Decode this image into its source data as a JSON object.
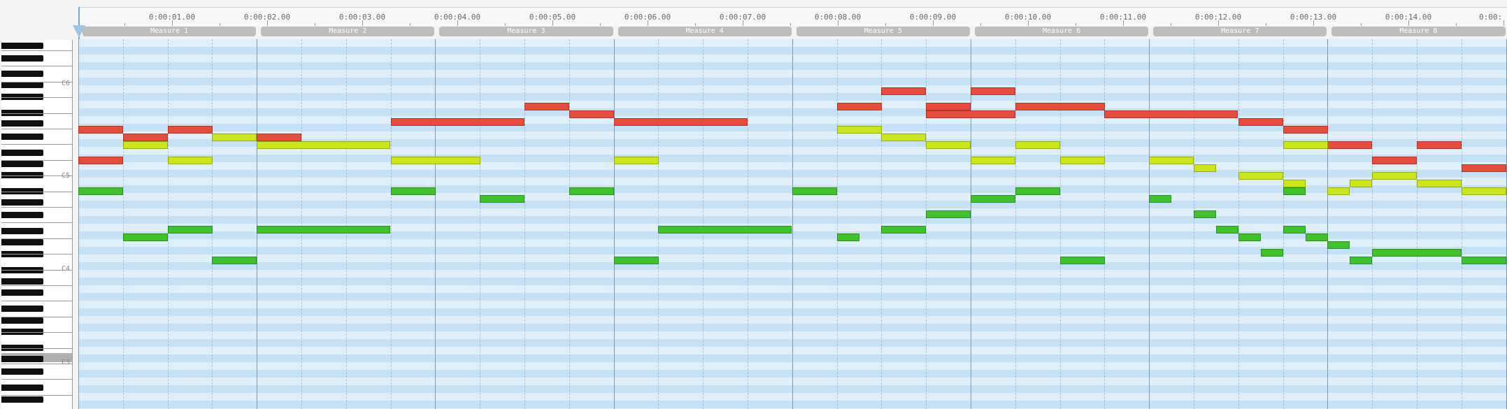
{
  "ruler": {
    "labels": [
      "0:00:01.00",
      "0:00:02.00",
      "0:00:03.00",
      "0:00:04.00",
      "0:00:05.00",
      "0:00:06.00",
      "0:00:07.00",
      "0:00:08.00",
      "0:00:09.00",
      "0:00:10.00",
      "0:00:11.00",
      "0:00:12.00",
      "0:00:13.00",
      "0:00:14.00",
      "0:00:"
    ]
  },
  "measures": [
    "Measure 1",
    "Measure 2",
    "Measure 3",
    "Measure 4",
    "Measure 5",
    "Measure 6",
    "Measure 7",
    "Measure 8"
  ],
  "keyboard": {
    "labels": [
      "C6",
      "C5",
      "C4",
      "C3"
    ],
    "highlighted_key": "C3"
  },
  "colors": {
    "melody": "#e84c3d",
    "harmony": "#cbe61a",
    "bass": "#3fc22c",
    "grid_light": "#dff0fb",
    "grid_dark": "#c4e1f6",
    "measure_tab": "#bdbdbd",
    "playhead": "#9fc4e4"
  },
  "piano_roll": {
    "beats_per_measure": 4,
    "note_start_unit": "beat",
    "pitch_unit": "row index from top",
    "tracks": [
      {
        "track": "red",
        "notes": [
          {
            "start": 0,
            "dur": 1,
            "row": 11
          },
          {
            "start": 1,
            "dur": 1,
            "row": 12
          },
          {
            "start": 2,
            "dur": 1,
            "row": 11
          },
          {
            "start": 4,
            "dur": 1,
            "row": 12
          },
          {
            "start": 7,
            "dur": 3,
            "row": 10
          },
          {
            "start": 10,
            "dur": 1,
            "row": 8
          },
          {
            "start": 11,
            "dur": 1,
            "row": 9
          },
          {
            "start": 12,
            "dur": 3,
            "row": 10
          },
          {
            "start": 17,
            "dur": 1,
            "row": 8
          },
          {
            "start": 18,
            "dur": 1,
            "row": 6
          },
          {
            "start": 19,
            "dur": 1,
            "row": 8
          },
          {
            "start": 19,
            "dur": 2,
            "row": 9
          },
          {
            "start": 20,
            "dur": 1,
            "row": 6
          },
          {
            "start": 21,
            "dur": 2,
            "row": 8
          },
          {
            "start": 23,
            "dur": 3,
            "row": 9
          },
          {
            "start": 26,
            "dur": 1,
            "row": 10
          },
          {
            "start": 27,
            "dur": 1,
            "row": 11
          },
          {
            "start": 28,
            "dur": 1,
            "row": 13
          },
          {
            "start": 29,
            "dur": 1,
            "row": 15
          },
          {
            "start": 30,
            "dur": 1,
            "row": 13
          },
          {
            "start": 31,
            "dur": 1,
            "row": 16
          },
          {
            "start": 0,
            "dur": 1,
            "row": 15
          }
        ]
      },
      {
        "track": "yellow",
        "notes": [
          {
            "start": 1,
            "dur": 1,
            "row": 13
          },
          {
            "start": 2,
            "dur": 1,
            "row": 15
          },
          {
            "start": 3,
            "dur": 1,
            "row": 12
          },
          {
            "start": 4,
            "dur": 3,
            "row": 13
          },
          {
            "start": 7,
            "dur": 2,
            "row": 15
          },
          {
            "start": 12,
            "dur": 1,
            "row": 15
          },
          {
            "start": 17,
            "dur": 1,
            "row": 11
          },
          {
            "start": 18,
            "dur": 1,
            "row": 12
          },
          {
            "start": 19,
            "dur": 1,
            "row": 13
          },
          {
            "start": 20,
            "dur": 1,
            "row": 15
          },
          {
            "start": 21,
            "dur": 1,
            "row": 13
          },
          {
            "start": 22,
            "dur": 1,
            "row": 15
          },
          {
            "start": 24,
            "dur": 1,
            "row": 15
          },
          {
            "start": 25,
            "dur": 0.5,
            "row": 16
          },
          {
            "start": 26,
            "dur": 1,
            "row": 17
          },
          {
            "start": 27,
            "dur": 0.5,
            "row": 18
          },
          {
            "start": 27,
            "dur": 1,
            "row": 13
          },
          {
            "start": 28,
            "dur": 0.5,
            "row": 19
          },
          {
            "start": 28.5,
            "dur": 0.5,
            "row": 18
          },
          {
            "start": 29,
            "dur": 1,
            "row": 17
          },
          {
            "start": 30,
            "dur": 1,
            "row": 18
          },
          {
            "start": 31,
            "dur": 1,
            "row": 19
          }
        ]
      },
      {
        "track": "green",
        "notes": [
          {
            "start": 0,
            "dur": 1,
            "row": 19
          },
          {
            "start": 1,
            "dur": 1,
            "row": 25
          },
          {
            "start": 2,
            "dur": 1,
            "row": 24
          },
          {
            "start": 3,
            "dur": 1,
            "row": 28
          },
          {
            "start": 4,
            "dur": 3,
            "row": 24
          },
          {
            "start": 7,
            "dur": 1,
            "row": 19
          },
          {
            "start": 9,
            "dur": 1,
            "row": 20
          },
          {
            "start": 11,
            "dur": 1,
            "row": 19
          },
          {
            "start": 12,
            "dur": 1,
            "row": 28
          },
          {
            "start": 13,
            "dur": 3,
            "row": 24
          },
          {
            "start": 16,
            "dur": 1,
            "row": 19
          },
          {
            "start": 17,
            "dur": 0.5,
            "row": 25
          },
          {
            "start": 18,
            "dur": 1,
            "row": 24
          },
          {
            "start": 19,
            "dur": 1,
            "row": 22
          },
          {
            "start": 20,
            "dur": 1,
            "row": 20
          },
          {
            "start": 21,
            "dur": 1,
            "row": 19
          },
          {
            "start": 22,
            "dur": 1,
            "row": 28
          },
          {
            "start": 24,
            "dur": 0.5,
            "row": 20
          },
          {
            "start": 25,
            "dur": 0.5,
            "row": 22
          },
          {
            "start": 25.5,
            "dur": 0.5,
            "row": 24
          },
          {
            "start": 26,
            "dur": 0.5,
            "row": 25
          },
          {
            "start": 26.5,
            "dur": 0.5,
            "row": 27
          },
          {
            "start": 27,
            "dur": 0.5,
            "row": 24
          },
          {
            "start": 27,
            "dur": 0.5,
            "row": 19
          },
          {
            "start": 27.5,
            "dur": 0.5,
            "row": 25
          },
          {
            "start": 28,
            "dur": 0.5,
            "row": 26
          },
          {
            "start": 28.5,
            "dur": 0.5,
            "row": 28
          },
          {
            "start": 29,
            "dur": 2,
            "row": 27
          },
          {
            "start": 31,
            "dur": 1,
            "row": 28
          }
        ]
      }
    ]
  }
}
